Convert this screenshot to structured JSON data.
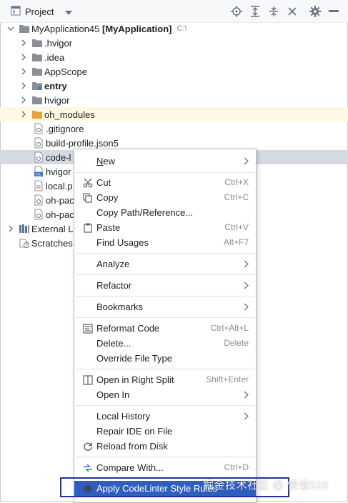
{
  "toolbar": {
    "title": "Project",
    "icons": [
      "project-view-icon",
      "dropdown-icon",
      "locate-icon",
      "expand-all-icon",
      "collapse-all-icon",
      "close-icon",
      "gear-icon",
      "hide-icon"
    ]
  },
  "tree": {
    "root": {
      "name": "MyApplication45",
      "module": "[MyApplication]",
      "path": "C:\\"
    },
    "items": [
      {
        "label": "MyApplication45",
        "type": "root"
      },
      {
        "label": ".hvigor",
        "type": "folder"
      },
      {
        "label": ".idea",
        "type": "folder"
      },
      {
        "label": "AppScope",
        "type": "folder"
      },
      {
        "label": "entry",
        "type": "module"
      },
      {
        "label": "hvigor",
        "type": "folder"
      },
      {
        "label": "oh_modules",
        "type": "folder-orange"
      },
      {
        "label": ".gitignore",
        "type": "file"
      },
      {
        "label": "build-profile.json5",
        "type": "file"
      },
      {
        "label": "code-l",
        "type": "file"
      },
      {
        "label": "hvigor",
        "type": "ts-file"
      },
      {
        "label": "local.p",
        "type": "file"
      },
      {
        "label": "oh-pac",
        "type": "file"
      },
      {
        "label": "oh-pac",
        "type": "file"
      },
      {
        "label": "External L",
        "type": "libraries"
      },
      {
        "label": "Scratches",
        "type": "scratches"
      }
    ]
  },
  "context_menu": {
    "items": [
      {
        "label": "New",
        "underline": "N",
        "rest": "ew",
        "submenu": true
      },
      {
        "label": "Cut",
        "shortcut": "Ctrl+X",
        "icon": "scissors-icon"
      },
      {
        "label": "Copy",
        "shortcut": "Ctrl+C",
        "icon": "copy-icon"
      },
      {
        "label": "Copy Path/Reference..."
      },
      {
        "label": "Paste",
        "shortcut": "Ctrl+V",
        "icon": "paste-icon"
      },
      {
        "label": "Find Usages",
        "shortcut": "Alt+F7"
      },
      {
        "label": "Analyze",
        "submenu": true
      },
      {
        "label": "Refactor",
        "submenu": true
      },
      {
        "label": "Bookmarks",
        "submenu": true
      },
      {
        "label": "Reformat Code",
        "shortcut": "Ctrl+Alt+L",
        "icon": "reformat-icon"
      },
      {
        "label": "Delete...",
        "shortcut": "Delete"
      },
      {
        "label": "Override File Type"
      },
      {
        "label": "Open in Right Split",
        "shortcut": "Shift+Enter",
        "icon": "split-icon"
      },
      {
        "label": "Open In",
        "submenu": true
      },
      {
        "label": "Local History",
        "submenu": true
      },
      {
        "label": "Repair IDE on File"
      },
      {
        "label": "Reload from Disk",
        "icon": "reload-icon"
      },
      {
        "label": "Compare With...",
        "shortcut": "Ctrl+D",
        "icon": "compare-icon"
      },
      {
        "label": "Apply CodeLinter Style Rules",
        "icon": "codelinter-icon",
        "active": true
      }
    ]
  },
  "watermark": "掘金技术社区 @ 慢慢529",
  "colors": {
    "selection": "#2e5fbd",
    "focus_box": "#2431a0",
    "folder": "#8a8f98",
    "folder_orange": "#e8a33c"
  }
}
